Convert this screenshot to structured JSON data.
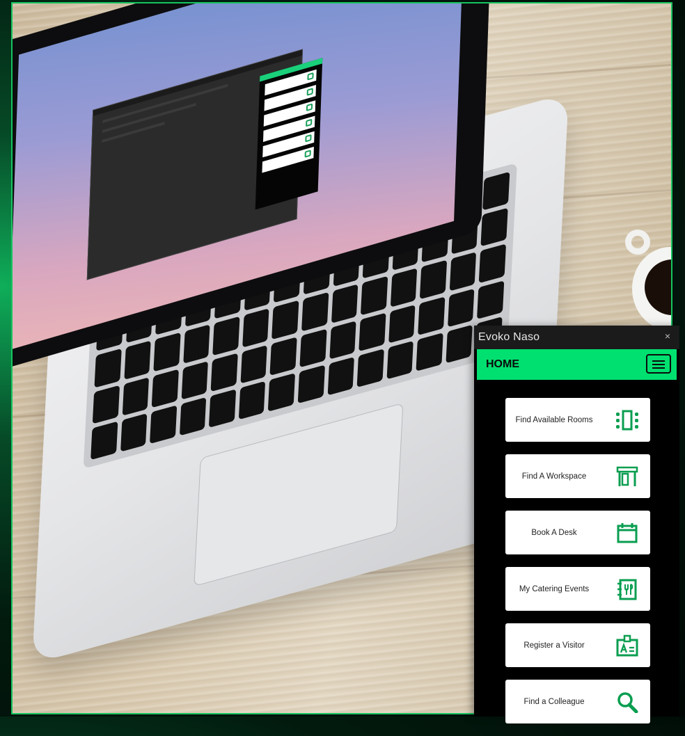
{
  "window": {
    "title": "Evoko Naso",
    "close_glyph": "×"
  },
  "header": {
    "title": "HOME",
    "menu_icon": "hamburger-menu-icon"
  },
  "tiles": [
    {
      "label": "Find Available Rooms",
      "icon": "room-icon"
    },
    {
      "label": "Find A Workspace",
      "icon": "workspace-icon"
    },
    {
      "label": "Book A Desk",
      "icon": "calendar-icon"
    },
    {
      "label": "My Catering Events",
      "icon": "catering-icon"
    },
    {
      "label": "Register a Visitor",
      "icon": "visitor-badge-icon"
    },
    {
      "label": "Find a Colleague",
      "icon": "search-icon"
    }
  ],
  "colors": {
    "accent": "#00e070",
    "icon": "#0a9e50",
    "panel_bg": "#000000",
    "frame_border": "#16c45f"
  }
}
